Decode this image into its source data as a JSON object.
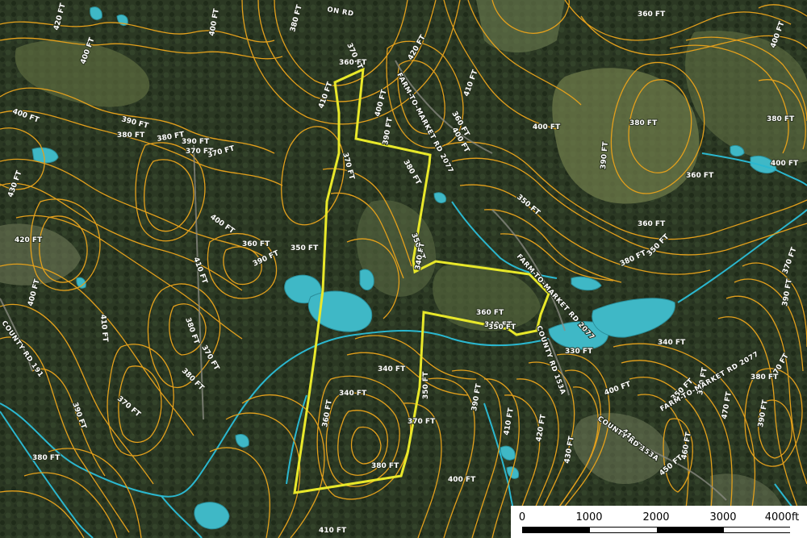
{
  "colors": {
    "contour": "#e3a01c",
    "contour_dark": "#b87a12",
    "boundary": "#e8e82a",
    "water": "#3fb8c6",
    "stream": "#2bb7cf",
    "forest": "#2a3a22",
    "pasture": "#5d6b3e"
  },
  "contour_labels": [
    "420 FT",
    "400 FT",
    "390 FT",
    "380 FT",
    "370 FT",
    "360 FT",
    "350 FT",
    "340 FT",
    "330 FT",
    "400 FT",
    "380 FT",
    "390 FT",
    "370 FT",
    "400 FT",
    "430 FT",
    "420 FT",
    "410 FT",
    "400 FT",
    "390 FT",
    "380 FT",
    "370 FT",
    "380 FT",
    "400 FT",
    "410 FT",
    "390 FT",
    "370 FT",
    "380 FT",
    "380 FT",
    "370 FT",
    "360 FT",
    "410 FT",
    "400 FT",
    "420 FT",
    "410 FT",
    "400 FT",
    "390 FT",
    "380 FT",
    "370 FT",
    "360 FT",
    "350 FT",
    "340 FT",
    "360 FT",
    "350 FT",
    "340 FT",
    "340 FT",
    "350 FT",
    "360 FT",
    "370 FT",
    "380 FT",
    "390 FT",
    "400 FT",
    "410 FT",
    "420 FT",
    "430 FT",
    "440 FT",
    "450 FT",
    "460 FT",
    "470 FT",
    "400 FT",
    "380 FT",
    "360 FT",
    "350 FT",
    "360 FT",
    "380 FT",
    "390 FT",
    "400 FT",
    "350 FT",
    "360 FT",
    "370 FT",
    "380 FT",
    "390 FT",
    "370 FT",
    "380 FT",
    "400 FT",
    "360 FT",
    "350 FT",
    "340 FT",
    "390 FT",
    "400 FT",
    "410 FT"
  ],
  "road_labels": {
    "fm_north": "FARM-TO-MARKET RD 2077",
    "fm_east": "FARM-TO-MARKET RD 2077",
    "county_153a_mid": "COUNTY RD 153A",
    "county_153a_south": "COUNTY RD 153A",
    "county_west": "COUNTY RD 191",
    "fm_southeast": "FARM-TO-MARKET RD 2077",
    "top_road": "ON RD"
  },
  "scale_bar": {
    "ticks": [
      "0",
      "1000",
      "2000",
      "3000",
      "4000ft"
    ]
  }
}
